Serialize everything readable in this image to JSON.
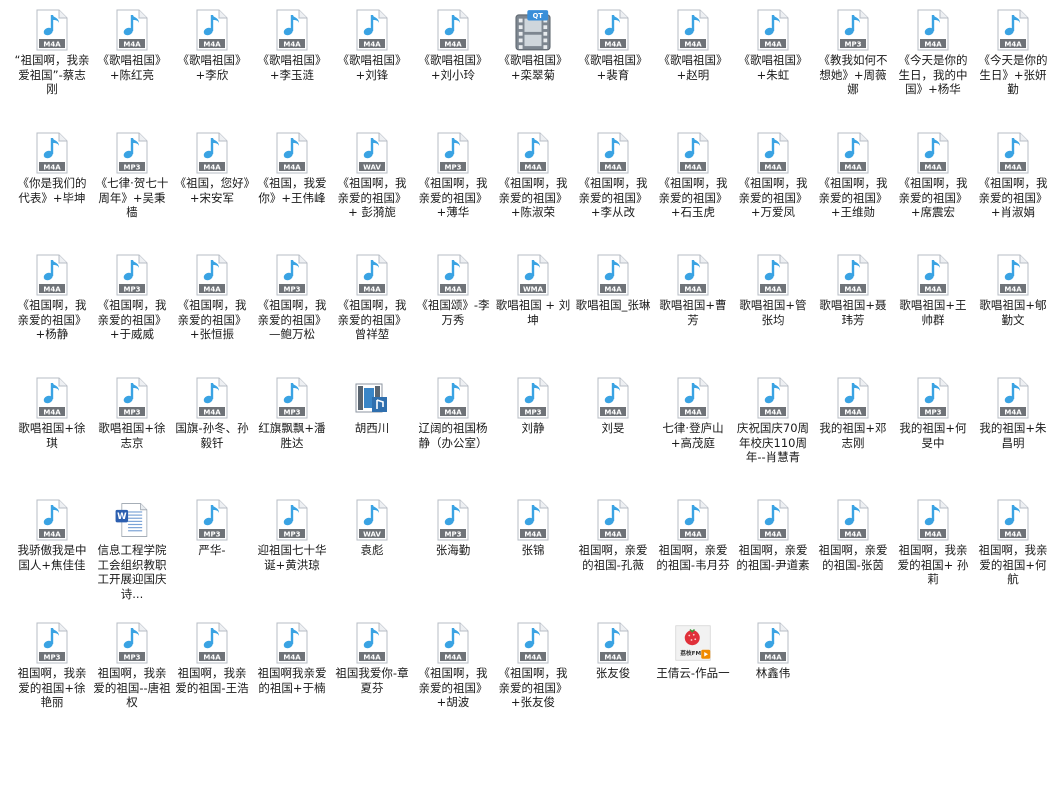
{
  "window": {
    "view": "large-icons",
    "background": "#ffffff"
  },
  "icon_styles": {
    "audio": {
      "page": "#ffffff",
      "border": "#b7bcc4",
      "note": "#3aa3e3",
      "badge": "#6f7378"
    },
    "video": "film-strip-icon",
    "word": "word-document-icon",
    "media": "media-file-icon",
    "image": "photo-thumbnail-icon"
  },
  "files": [
    {
      "name": "“祖国啊，我亲爱祖国”-蔡志刚",
      "type": "M4A",
      "kind": "audio"
    },
    {
      "name": "《歌唱祖国》+陈红亮",
      "type": "M4A",
      "kind": "audio"
    },
    {
      "name": "《歌唱祖国》+李欣",
      "type": "M4A",
      "kind": "audio"
    },
    {
      "name": "《歌唱祖国》+李玉涟",
      "type": "M4A",
      "kind": "audio"
    },
    {
      "name": "《歌唱祖国》+刘锋",
      "type": "M4A",
      "kind": "audio"
    },
    {
      "name": "《歌唱祖国》+刘小玲",
      "type": "M4A",
      "kind": "audio"
    },
    {
      "name": "《歌唱祖国》+栾翠菊",
      "type": "QT",
      "kind": "video"
    },
    {
      "name": "《歌唱祖国》+裴育",
      "type": "M4A",
      "kind": "audio"
    },
    {
      "name": "《歌唱祖国》+赵明",
      "type": "M4A",
      "kind": "audio"
    },
    {
      "name": "《歌唱祖国》+朱虹",
      "type": "M4A",
      "kind": "audio"
    },
    {
      "name": "《教我如何不想她》+周薇娜",
      "type": "MP3",
      "kind": "audio"
    },
    {
      "name": "《今天是你的生日，我的中国》+杨华",
      "type": "M4A",
      "kind": "audio"
    },
    {
      "name": "《今天是你的生日》+张妍勤",
      "type": "M4A",
      "kind": "audio"
    },
    {
      "name": "《你是我们的代表》+毕坤",
      "type": "M4A",
      "kind": "audio"
    },
    {
      "name": "《七律·贺七十周年》+吴秉樯",
      "type": "MP3",
      "kind": "audio"
    },
    {
      "name": "《祖国，您好》+宋安军",
      "type": "M4A",
      "kind": "audio"
    },
    {
      "name": "《祖国，我爱你》+王伟峰",
      "type": "M4A",
      "kind": "audio"
    },
    {
      "name": "《祖国啊，我亲爱的祖国》+ 彭漪旎",
      "type": "WAV",
      "kind": "audio"
    },
    {
      "name": "《祖国啊，我亲爱的祖国》+薄华",
      "type": "MP3",
      "kind": "audio"
    },
    {
      "name": "《祖国啊，我亲爱的祖国》+陈淑荣",
      "type": "M4A",
      "kind": "audio"
    },
    {
      "name": "《祖国啊，我亲爱的祖国》+李从改",
      "type": "M4A",
      "kind": "audio"
    },
    {
      "name": "《祖国啊，我亲爱的祖国》+石玉虎",
      "type": "M4A",
      "kind": "audio"
    },
    {
      "name": "《祖国啊，我亲爱的祖国》+万爱凤",
      "type": "M4A",
      "kind": "audio"
    },
    {
      "name": "《祖国啊，我亲爱的祖国》+王维勋",
      "type": "M4A",
      "kind": "audio"
    },
    {
      "name": "《祖国啊，我亲爱的祖国》+席震宏",
      "type": "M4A",
      "kind": "audio"
    },
    {
      "name": "《祖国啊，我亲爱的祖国》+肖淑娟",
      "type": "M4A",
      "kind": "audio"
    },
    {
      "name": "《祖国啊，我亲爱的祖国》+杨静",
      "type": "M4A",
      "kind": "audio"
    },
    {
      "name": "《祖国啊，我亲爱的祖国》+于威威",
      "type": "MP3",
      "kind": "audio"
    },
    {
      "name": "《祖国啊，我亲爱的祖国》+张恒振",
      "type": "M4A",
      "kind": "audio"
    },
    {
      "name": "《祖国啊，我亲爱的祖国》—鲍万松",
      "type": "MP3",
      "kind": "audio"
    },
    {
      "name": "《祖国啊，我亲爱的祖国》曾祥堃",
      "type": "M4A",
      "kind": "audio"
    },
    {
      "name": "《祖国颂》-李万秀",
      "type": "M4A",
      "kind": "audio"
    },
    {
      "name": "歌唱祖国 + 刘坤",
      "type": "WMA",
      "kind": "audio"
    },
    {
      "name": "歌唱祖国_张琳",
      "type": "M4A",
      "kind": "audio"
    },
    {
      "name": "歌唱祖国+曹芳",
      "type": "M4A",
      "kind": "audio"
    },
    {
      "name": "歌唱祖国+管张均",
      "type": "M4A",
      "kind": "audio"
    },
    {
      "name": "歌唱祖国+聂玮芳",
      "type": "M4A",
      "kind": "audio"
    },
    {
      "name": "歌唱祖国+王帅群",
      "type": "M4A",
      "kind": "audio"
    },
    {
      "name": "歌唱祖国+郇勤文",
      "type": "M4A",
      "kind": "audio"
    },
    {
      "name": "歌唱祖国+徐琪",
      "type": "M4A",
      "kind": "audio"
    },
    {
      "name": "歌唱祖国+徐志京",
      "type": "MP3",
      "kind": "audio"
    },
    {
      "name": "国旗-孙冬、孙毅钎",
      "type": "M4A",
      "kind": "audio"
    },
    {
      "name": "红旗飘飘+潘胜达",
      "type": "MP3",
      "kind": "audio"
    },
    {
      "name": "胡西川",
      "type": "",
      "kind": "media"
    },
    {
      "name": "辽阔的祖国杨静（办公室）",
      "type": "M4A",
      "kind": "audio"
    },
    {
      "name": "刘静",
      "type": "MP3",
      "kind": "audio"
    },
    {
      "name": "刘旻",
      "type": "M4A",
      "kind": "audio"
    },
    {
      "name": "七律·登庐山+高茂庭",
      "type": "M4A",
      "kind": "audio"
    },
    {
      "name": "庆祝国庆70周年校庆110周年--肖慧青",
      "type": "M4A",
      "kind": "audio"
    },
    {
      "name": "我的祖国+邓志刚",
      "type": "M4A",
      "kind": "audio"
    },
    {
      "name": "我的祖国+何旻中",
      "type": "MP3",
      "kind": "audio"
    },
    {
      "name": "我的祖国+朱昌明",
      "type": "M4A",
      "kind": "audio"
    },
    {
      "name": "我骄傲我是中国人+焦佳佳",
      "type": "M4A",
      "kind": "audio"
    },
    {
      "name": "信息工程学院工会组织教职工开展迎国庆诗...",
      "type": "",
      "kind": "word"
    },
    {
      "name": "严华-",
      "type": "MP3",
      "kind": "audio"
    },
    {
      "name": "迎祖国七十华诞+黄洪琼",
      "type": "MP3",
      "kind": "audio"
    },
    {
      "name": "袁彪",
      "type": "WAV",
      "kind": "audio"
    },
    {
      "name": "张海勤",
      "type": "MP3",
      "kind": "audio"
    },
    {
      "name": "张锦",
      "type": "M4A",
      "kind": "audio"
    },
    {
      "name": "祖国啊，亲爱的祖国-孔薇",
      "type": "M4A",
      "kind": "audio"
    },
    {
      "name": "祖国啊，亲爱的祖国-韦月芬",
      "type": "M4A",
      "kind": "audio"
    },
    {
      "name": "祖国啊，亲爱的祖国-尹道素",
      "type": "M4A",
      "kind": "audio"
    },
    {
      "name": "祖国啊，亲爱的祖国-张茵",
      "type": "M4A",
      "kind": "audio"
    },
    {
      "name": "祖国啊，我亲爱的祖国+ 孙莉",
      "type": "M4A",
      "kind": "audio"
    },
    {
      "name": "祖国啊，我亲爱的祖国+何航",
      "type": "M4A",
      "kind": "audio"
    },
    {
      "name": "祖国啊，我亲爱的祖国+徐艳丽",
      "type": "MP3",
      "kind": "audio"
    },
    {
      "name": "祖国啊，我亲爱的祖国--唐祖权",
      "type": "MP3",
      "kind": "audio"
    },
    {
      "name": "祖国啊，我亲爱的祖国-王浩",
      "type": "M4A",
      "kind": "audio"
    },
    {
      "name": "祖国啊我亲爱的祖国+于楠",
      "type": "M4A",
      "kind": "audio"
    },
    {
      "name": "祖国我爱你-章夏芬",
      "type": "M4A",
      "kind": "audio"
    },
    {
      "name": "《祖国啊，我亲爱的祖国》+胡波",
      "type": "M4A",
      "kind": "audio"
    },
    {
      "name": "《祖国啊，我亲爱的祖国》+张友俊",
      "type": "M4A",
      "kind": "audio"
    },
    {
      "name": "张友俊",
      "type": "M4A",
      "kind": "audio"
    },
    {
      "name": "王倩云-作品一",
      "type": "",
      "kind": "image",
      "thumb_text": "荔枝FM"
    },
    {
      "name": "林鑫伟",
      "type": "M4A",
      "kind": "audio"
    }
  ]
}
